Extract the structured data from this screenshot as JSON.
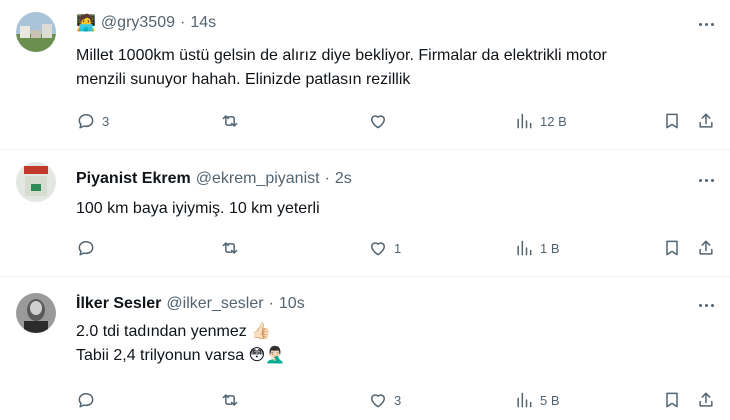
{
  "tweets": [
    {
      "name": "",
      "badge": "🧑‍💻",
      "handle": "@gry3509",
      "time": "14s",
      "lines": [
        "Millet 1000km üstü gelsin de alırız diye bekliyor. Firmalar da elektrikli motor",
        "menzili sunuyor hahah. Elinizde patlasın rezillik"
      ],
      "replies": "3",
      "reposts": "",
      "likes": "",
      "views": "12 B"
    },
    {
      "name": "Piyanist Ekrem",
      "badge": "",
      "handle": "@ekrem_piyanist",
      "time": "2s",
      "lines": [
        "100 km baya iyiymiş. 10 km yeterli"
      ],
      "replies": "",
      "reposts": "",
      "likes": "1",
      "views": "1 B"
    },
    {
      "name": "İlker Sesler",
      "badge": "",
      "handle": "@ilker_sesler",
      "time": "10s",
      "lines": [
        "2.0 tdi  tadından yenmez 👍🏻",
        "Tabii 2,4 trilyonun varsa 😳🤦🏻‍♂️"
      ],
      "replies": "",
      "reposts": "",
      "likes": "3",
      "views": "5 B"
    }
  ],
  "separator": "·"
}
